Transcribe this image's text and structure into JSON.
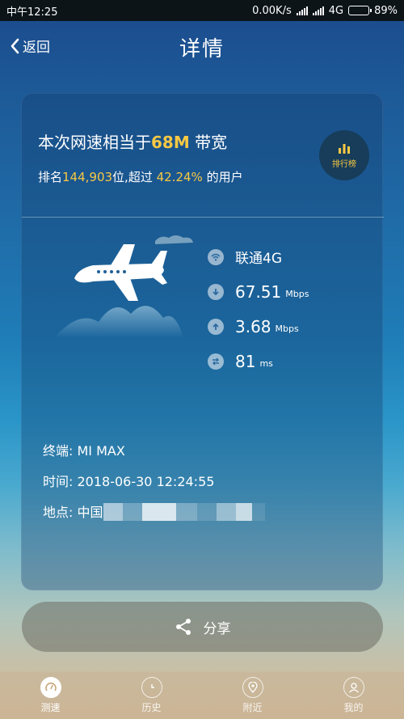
{
  "status_bar": {
    "time": "中午12:25",
    "speed": "0.00K/s",
    "network": "4G",
    "battery": "89%",
    "battery_level": 0.89
  },
  "header": {
    "back_label": "返回",
    "title": "详情"
  },
  "summary": {
    "headline_prefix": "本次网速相当于",
    "headline_value": "68M",
    "headline_suffix": "带宽",
    "rank_prefix": "排名",
    "rank_value": "144,903",
    "rank_middle": "位,超过",
    "rank_percent": "42.24%",
    "rank_suffix": "的用户",
    "ranking_button_label": "排行榜"
  },
  "metrics": {
    "network": "联通4G",
    "download_value": "67.51",
    "download_unit": "Mbps",
    "upload_value": "3.68",
    "upload_unit": "Mbps",
    "ping_value": "81",
    "ping_unit": "ms"
  },
  "device_info": {
    "terminal_label": "终端:",
    "terminal_value": "MI MAX",
    "time_label": "时间:",
    "time_value": "2018-06-30 12:24:55",
    "location_label": "地点:",
    "location_value": "中国"
  },
  "share": {
    "label": "分享"
  },
  "tabs": [
    {
      "label": "测速",
      "icon": "speedometer-icon",
      "active": true
    },
    {
      "label": "历史",
      "icon": "clock-icon",
      "active": false
    },
    {
      "label": "附近",
      "icon": "location-pin-icon",
      "active": false
    },
    {
      "label": "我的",
      "icon": "user-icon",
      "active": false
    }
  ],
  "colors": {
    "accent": "#f7c843",
    "rank_button_bg": "#173d5a"
  }
}
